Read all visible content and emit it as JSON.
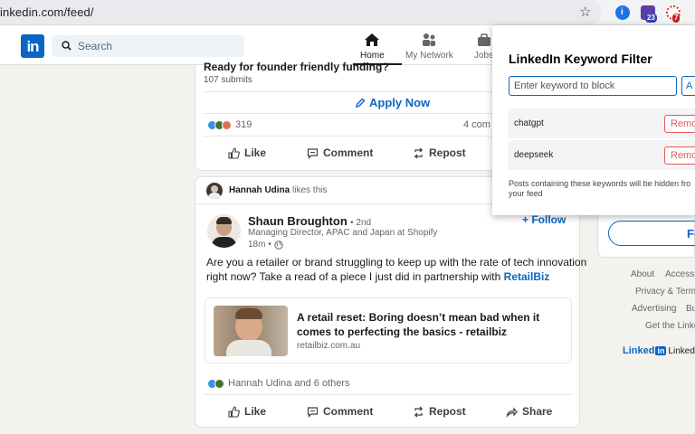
{
  "browser": {
    "url": "inkedin.com/feed/",
    "extensions": [
      {
        "name": "info-extension-icon",
        "color": "#1a73e8"
      },
      {
        "name": "house-extension-icon",
        "color": "#5b3fa8",
        "badge": "23",
        "badge_color": "#3c3fa8"
      },
      {
        "name": "bug-extension-icon",
        "color": "#d93025",
        "badge": "7",
        "badge_color": "#c5221f"
      }
    ]
  },
  "header": {
    "logo": "in",
    "search_placeholder": "Search",
    "nav": {
      "home": "Home",
      "network": "My Network",
      "jobs": "Jobs"
    }
  },
  "post1": {
    "cut_title": "Ready for founder friendly funding?",
    "submits": "107 submits",
    "cta": "Apply Now",
    "reaction_count": "319",
    "comments_partial": "4 com",
    "actions": {
      "like": "Like",
      "comment": "Comment",
      "repost": "Repost"
    }
  },
  "post2": {
    "activity_name": "Hannah Udina",
    "activity_text": "likes this",
    "author": "Shaun Broughton",
    "degree": "• 2nd",
    "headline": "Managing Director, APAC and Japan at Shopify",
    "time": "18m •",
    "follow": "+ Follow",
    "body_line1": "Are you a retailer or brand struggling to keep up with the rate of tech innovation",
    "body_line2_prefix": "right now? Take a read of a piece I just did in partnership with",
    "body_link": "RetailBiz",
    "article_title_line1": "A retail reset: Boring doesn’t mean bad when it",
    "article_title_line2": "comes to perfecting the basics - retailbiz",
    "article_domain": "retailbiz.com.au",
    "reactions_text": "Hannah Udina and 6 others",
    "actions": {
      "like": "Like",
      "comment": "Comment",
      "repost": "Repost",
      "share": "Share"
    }
  },
  "right": {
    "follow_label": "Fo",
    "footer": {
      "about": "About",
      "accessibility": "Accessi",
      "privacy": "Privacy & Term",
      "advertising": "Advertising",
      "business": "Bu",
      "get_app": "Get the Linke",
      "brand": "LinkedIn"
    }
  },
  "popup": {
    "title": "LinkedIn Keyword Filter",
    "input_placeholder": "Enter keyword to block",
    "add_label": "A",
    "keywords": [
      "chatgpt",
      "deepseek"
    ],
    "remove_label": "Remo",
    "note_line1": "Posts containing these keywords will be hidden fro",
    "note_line2": "your feed"
  }
}
